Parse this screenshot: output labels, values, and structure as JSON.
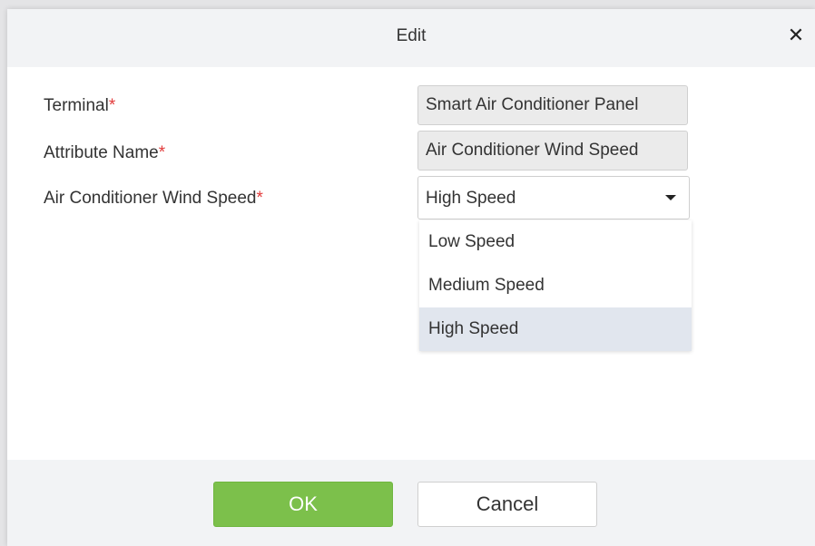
{
  "dialog": {
    "title": "Edit",
    "close_glyph": "✕"
  },
  "form": {
    "required_mark": "*",
    "terminal": {
      "label": "Terminal",
      "value": "Smart Air Conditioner Panel"
    },
    "attribute_name": {
      "label": "Attribute Name",
      "value": "Air Conditioner Wind Speed"
    },
    "wind_speed": {
      "label": "Air Conditioner Wind Speed",
      "selected": "High Speed",
      "options": [
        "Low Speed",
        "Medium Speed",
        "High Speed"
      ]
    }
  },
  "footer": {
    "ok_label": "OK",
    "cancel_label": "Cancel"
  },
  "colors": {
    "accent_green": "#7cc04b",
    "required_red": "#e23b3b",
    "selected_option_bg": "#e1e6ee"
  },
  "icons": {
    "close": "close-icon",
    "dropdown": "caret-down-icon"
  }
}
